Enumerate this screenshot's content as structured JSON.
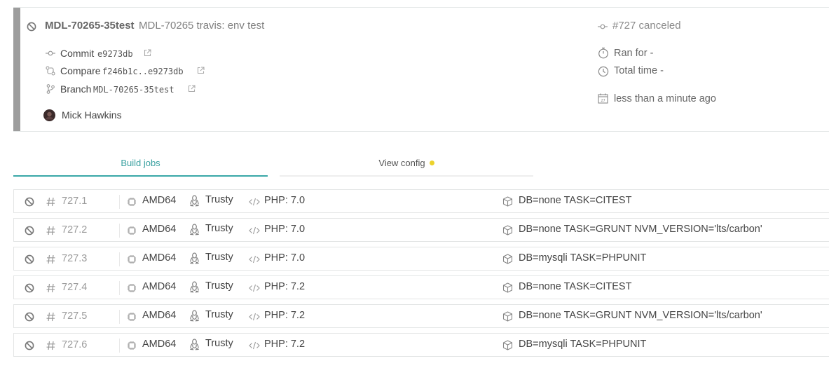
{
  "build": {
    "branch": "MDL-70265-35test",
    "message": "MDL-70265 travis: env test",
    "commit_label": "Commit",
    "commit_sha": "e9273db",
    "compare_label": "Compare",
    "compare_range": "f246b1c..e9273db",
    "branch_label": "Branch",
    "branch_name": "MDL-70265-35test",
    "author": "Mick Hawkins",
    "build_status": "#727 canceled",
    "ran_for": "Ran for -",
    "total_time": "Total time -",
    "finished": "less than a minute ago",
    "status_color": "#9d9d9d"
  },
  "tabs": {
    "build_jobs": "Build jobs",
    "view_config": "View config"
  },
  "colors": {
    "accent": "#39a7a7",
    "config_dot": "#ecd22b"
  },
  "jobs": [
    {
      "number": "727.1",
      "arch": "AMD64",
      "os": "Trusty",
      "language": "PHP: 7.0",
      "env": "DB=none TASK=CITEST"
    },
    {
      "number": "727.2",
      "arch": "AMD64",
      "os": "Trusty",
      "language": "PHP: 7.0",
      "env": "DB=none TASK=GRUNT NVM_VERSION='lts/carbon'"
    },
    {
      "number": "727.3",
      "arch": "AMD64",
      "os": "Trusty",
      "language": "PHP: 7.0",
      "env": "DB=mysqli TASK=PHPUNIT"
    },
    {
      "number": "727.4",
      "arch": "AMD64",
      "os": "Trusty",
      "language": "PHP: 7.2",
      "env": "DB=none TASK=CITEST"
    },
    {
      "number": "727.5",
      "arch": "AMD64",
      "os": "Trusty",
      "language": "PHP: 7.2",
      "env": "DB=none TASK=GRUNT NVM_VERSION='lts/carbon'"
    },
    {
      "number": "727.6",
      "arch": "AMD64",
      "os": "Trusty",
      "language": "PHP: 7.2",
      "env": "DB=mysqli TASK=PHPUNIT"
    }
  ]
}
